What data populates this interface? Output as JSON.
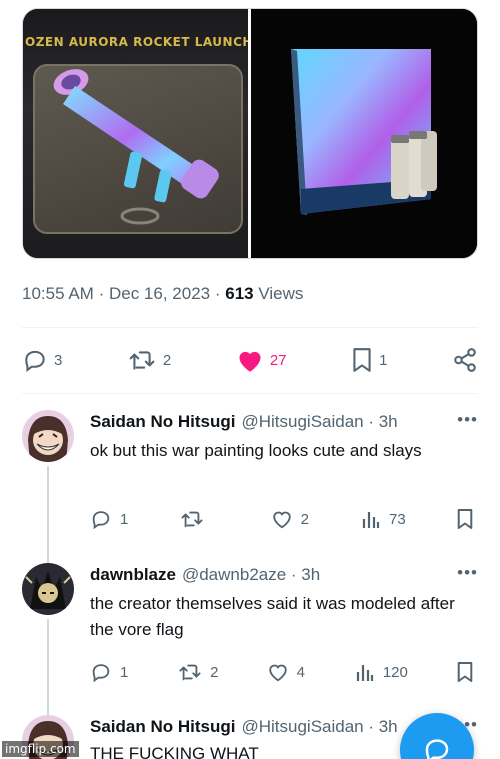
{
  "tweet": {
    "media_caption": "OZEN AURORA ROCKET LAUNCHE",
    "time": "10:55 AM",
    "date": "Dec 16, 2023",
    "views_count": "613",
    "views_label": "Views",
    "dot": "·",
    "actions": {
      "replies": "3",
      "retweets": "2",
      "likes": "27",
      "bookmarks": "1"
    }
  },
  "replies": [
    {
      "name": "Saidan No Hitsugi",
      "handle": "@HitsugiSaidan · 3h",
      "text": "ok but this war painting looks cute and slays",
      "replies": "1",
      "retweets": "",
      "likes": "2",
      "views": "73"
    },
    {
      "name": "dawnblaze",
      "handle": "@dawnb2aze · 3h",
      "text": "the creator themselves said it was modeled after the vore flag",
      "replies": "1",
      "retweets": "2",
      "likes": "4",
      "views": "120"
    },
    {
      "name": "Saidan No Hitsugi",
      "handle": "@HitsugiSaidan · 3h",
      "text": "THE FUCKING WHAT"
    }
  ],
  "more_label": "•••",
  "watermark": "imgflip.com",
  "colors": {
    "like_pink": "#f91880",
    "gray": "#536471",
    "accent_blue": "#1d9bf0"
  }
}
